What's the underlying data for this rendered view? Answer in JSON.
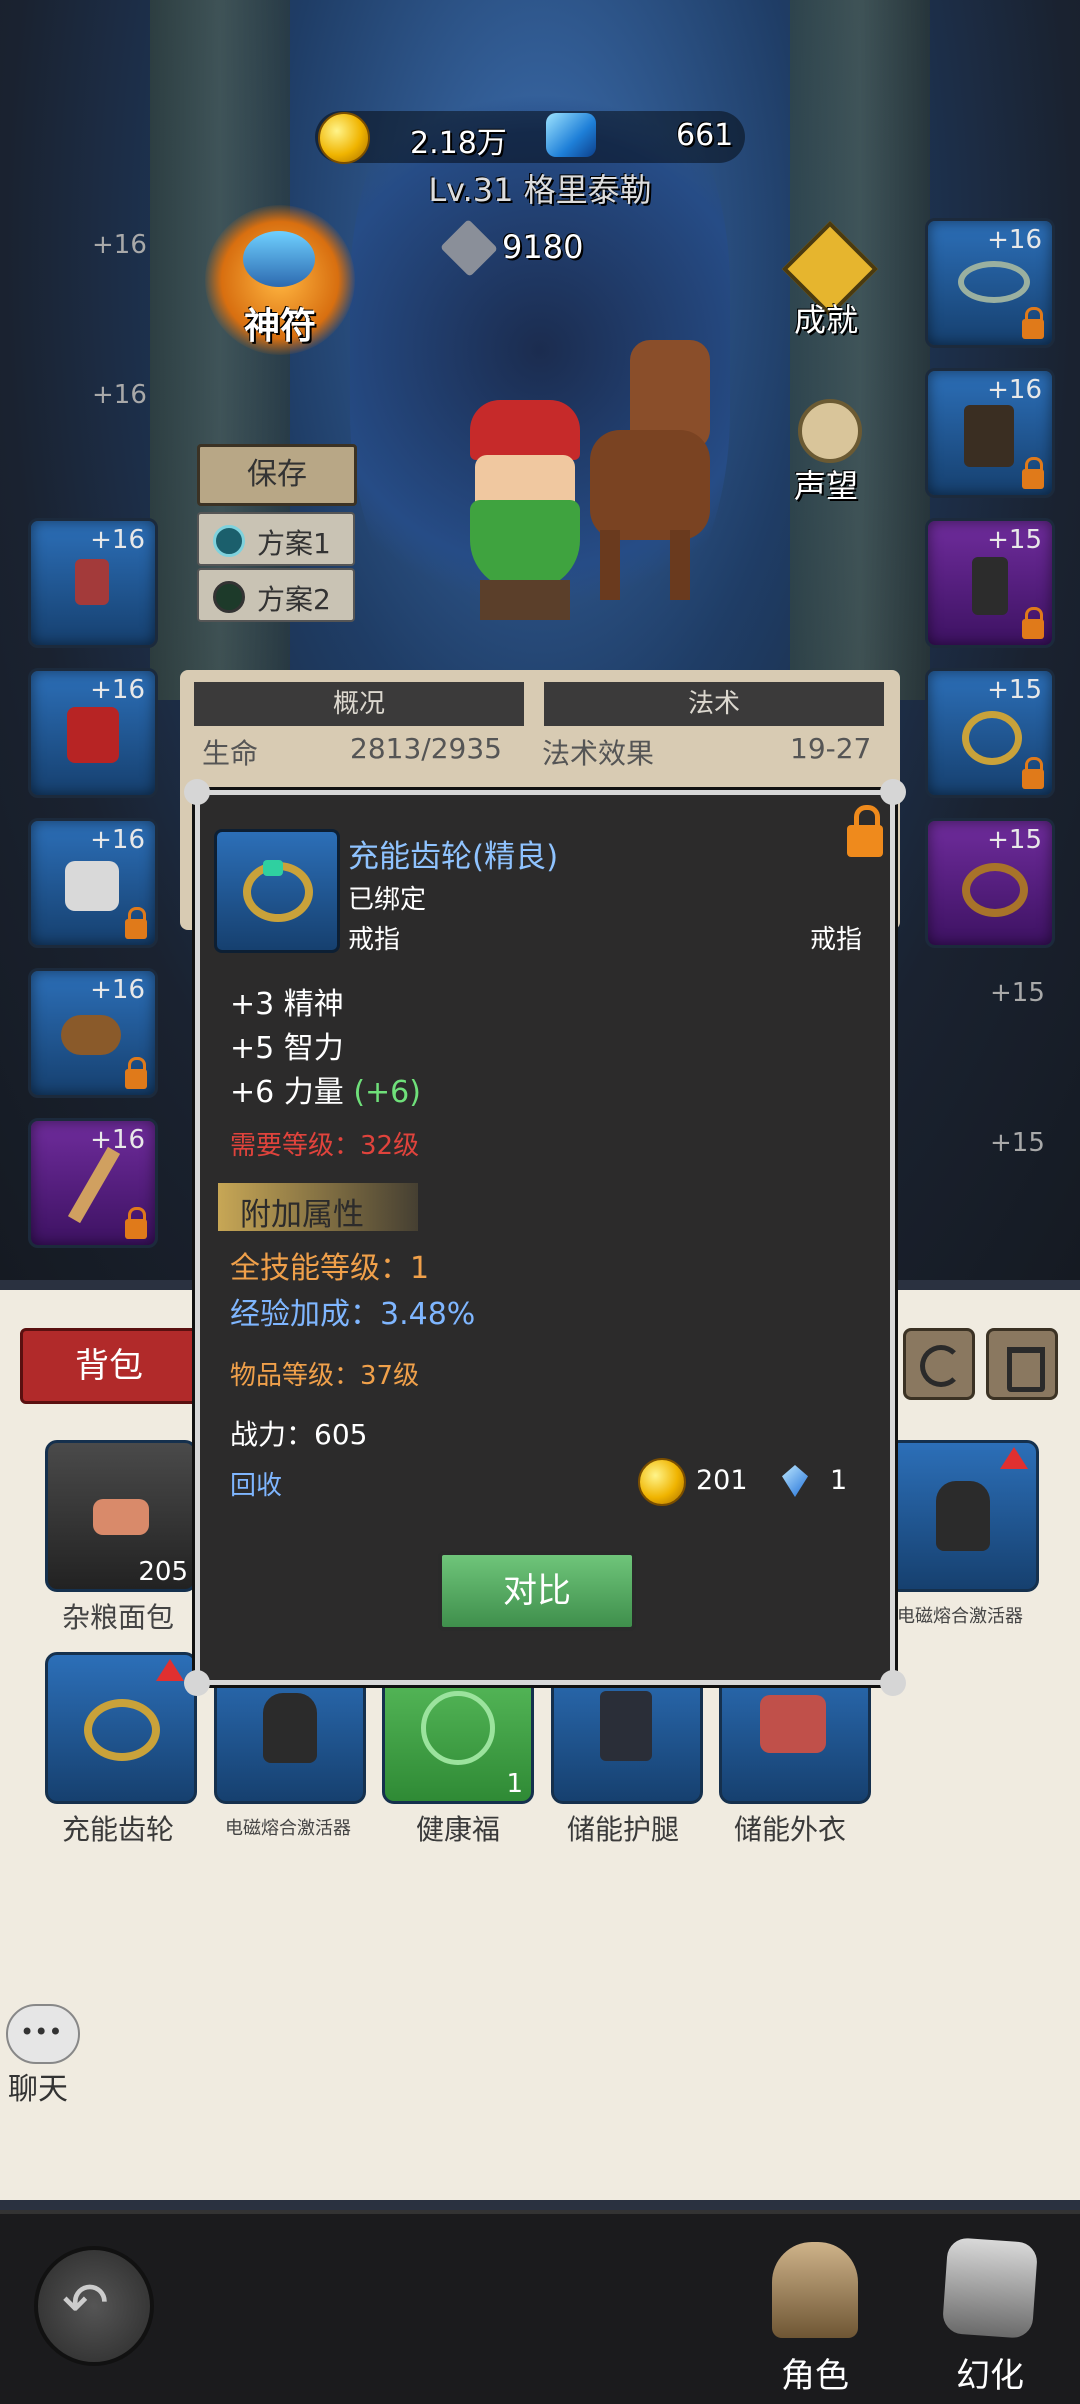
{
  "header": {
    "gold": "2.18万",
    "gems": "661",
    "player_line": "Lv.31 格里泰勒",
    "power": "9180"
  },
  "hero_menu": {
    "rune_label": "神符",
    "achievement_label": "成就",
    "reputation_label": "声望",
    "save_label": "保存",
    "plan1_label": "方案1",
    "plan2_label": "方案2"
  },
  "left_slots": [
    {
      "plus": "+16",
      "visible": false
    },
    {
      "plus": "+16",
      "visible": false
    },
    {
      "plus": "+16",
      "tier": "blue"
    },
    {
      "plus": "+16",
      "tier": "blue"
    },
    {
      "plus": "+16",
      "tier": "blue",
      "locked": true
    },
    {
      "plus": "+16",
      "tier": "blue",
      "locked": true
    },
    {
      "plus": "+16",
      "tier": "purple",
      "locked": true
    }
  ],
  "right_slots": [
    {
      "plus": "+16",
      "tier": "blue",
      "locked": true
    },
    {
      "plus": "+16",
      "tier": "blue",
      "locked": true
    },
    {
      "plus": "+15",
      "tier": "purple",
      "locked": true
    },
    {
      "plus": "+15",
      "tier": "blue",
      "locked": true
    },
    {
      "plus": "+15",
      "tier": "purple"
    },
    {
      "plus": "+15",
      "visible": false
    },
    {
      "plus": "+15",
      "visible": false
    }
  ],
  "stats_panel": {
    "overview_title": "概况",
    "spell_title": "法术",
    "life_label": "生命",
    "life_value": "2813/2935",
    "spell_effect_label": "法术效果",
    "spell_effect_value": "19-27"
  },
  "bag": {
    "tab_label": "背包",
    "items": [
      {
        "name": "杂粮面包",
        "count": "205"
      },
      {
        "name": "电磁熔合激活器"
      },
      {
        "name": "充能齿轮"
      },
      {
        "name": "电磁熔合激活器"
      },
      {
        "name": "健康福",
        "count": "1"
      },
      {
        "name": "储能护腿"
      },
      {
        "name": "储能外衣"
      }
    ]
  },
  "chat_label": "聊天",
  "bottom_nav": {
    "role_label": "角色",
    "illusion_label": "幻化"
  },
  "modal": {
    "item_title": "充能齿轮(精良)",
    "bound": "已绑定",
    "type_left": "戒指",
    "type_right": "戒指",
    "stats": [
      {
        "text": "+3 精神"
      },
      {
        "text": "+5 智力"
      },
      {
        "text": "+6 力量",
        "bonus": "(+6)"
      }
    ],
    "required_level": "需要等级：32级",
    "extra_header": "附加属性",
    "extra_stats": [
      "全技能等级：1",
      "经验加成：3.48%"
    ],
    "item_level": "物品等级：37级",
    "power": "战力：605",
    "recycle_label": "回收",
    "sell_gold": "201",
    "sell_gems": "1",
    "compare_label": "对比"
  },
  "colors": {
    "title_blue": "#8fc3ff",
    "required_red": "#e0433c",
    "orange": "#f0a04a",
    "exp_blue": "#7fb6ff",
    "bonus_green": "#6fe07a"
  }
}
